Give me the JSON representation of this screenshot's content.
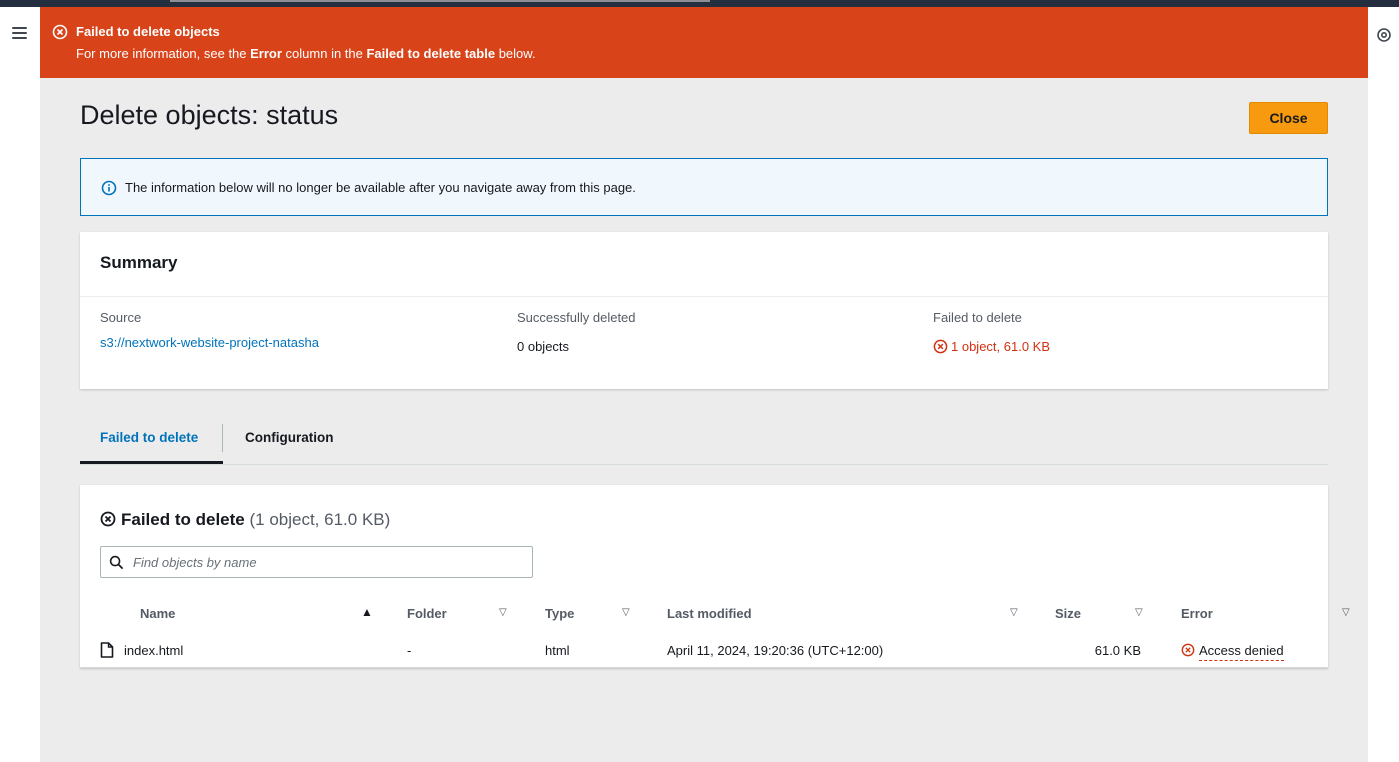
{
  "flash": {
    "title": "Failed to delete objects",
    "body_pre": "For more information, see the ",
    "body_bold1": "Error",
    "body_mid": " column in the ",
    "body_bold2": "Failed to delete table",
    "body_post": " below.",
    "color": "#d8431a"
  },
  "page": {
    "title": "Delete objects: status",
    "close_label": "Close"
  },
  "info": {
    "text": "The information below will no longer be available after you navigate away from this page."
  },
  "summary": {
    "title": "Summary",
    "source_label": "Source",
    "source_value": "s3://nextwork-website-project-natasha",
    "success_label": "Successfully deleted",
    "success_value": "0 objects",
    "failed_label": "Failed to delete",
    "failed_value": "1 object, 61.0 KB"
  },
  "tabs": [
    {
      "label": "Failed to delete",
      "active": true
    },
    {
      "label": "Configuration",
      "active": false
    }
  ],
  "failed_table": {
    "title": "Failed to delete",
    "count": "(1 object, 61.0 KB)",
    "search_placeholder": "Find objects by name",
    "columns": [
      "Name",
      "Folder",
      "Type",
      "Last modified",
      "Size",
      "Error"
    ],
    "rows": [
      {
        "name": "index.html",
        "folder": "-",
        "type": "html",
        "last_modified": "April 11, 2024, 19:20:36 (UTC+12:00)",
        "size": "61.0 KB",
        "error": "Access denied"
      }
    ]
  },
  "colors": {
    "accent": "#0073bb",
    "error": "#d13212",
    "primary_button": "#f79a0f"
  }
}
